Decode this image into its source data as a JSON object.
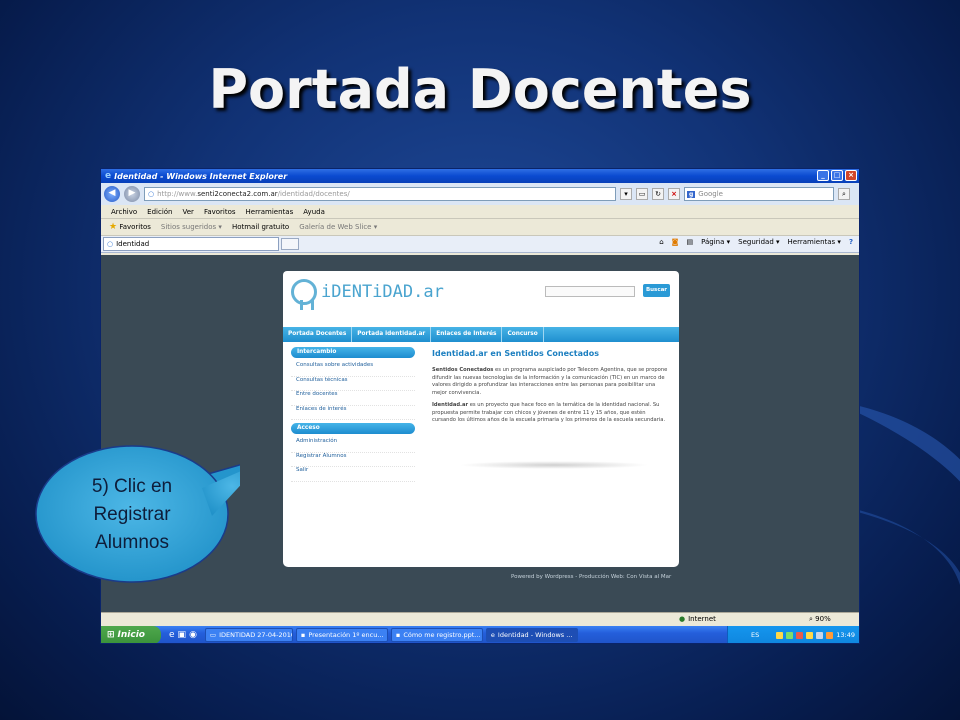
{
  "slide": {
    "title": "Portada Docentes"
  },
  "window": {
    "title": "Identidad - Windows Internet Explorer",
    "min": "_",
    "max": "□",
    "close": "×"
  },
  "address": {
    "url_prefix": "http://www.",
    "url_host": "senti2conecta2.com.ar",
    "url_path": "/identidad/docentes/",
    "search_placeholder": "Google"
  },
  "menu": [
    "Archivo",
    "Edición",
    "Ver",
    "Favoritos",
    "Herramientas",
    "Ayuda"
  ],
  "favorites": {
    "label": "Favoritos",
    "items": [
      "Sitios sugeridos ▾",
      "Hotmail gratuito",
      "Galería de Web Slice ▾"
    ]
  },
  "tab": {
    "label": "Identidad"
  },
  "commands": [
    "Página ▾",
    "Seguridad ▾",
    "Herramientas ▾"
  ],
  "site": {
    "logo": "iDENTiDAD.ar",
    "search_button": "Buscar",
    "nav": [
      "Portada Docentes",
      "Portada identidad.ar",
      "Enlaces de Interés",
      "Concurso"
    ],
    "sidebar": {
      "section1": "Intercambio",
      "links1": [
        "Consultas sobre actividades",
        "Consultas técnicas",
        "Entre docentes",
        "Enlaces de interés"
      ],
      "section2": "Acceso",
      "links2": [
        "Administración",
        "Registrar Alumnos",
        "Salir"
      ]
    },
    "article": {
      "title": "Identidad.ar en Sentidos Conectados",
      "p1_bold": "Sentidos Conectados",
      "p1": " es un programa auspiciado por Telecom Agentina, que se propone difundir las nuevas tecnologías de la información y la comunicación (TIC) en un marco de valores dirigido a profundizar las interacciones entre las personas para posibilitar una mejor convivencia.",
      "p2_bold": "Identidad.ar",
      "p2": " es un proyecto que hace foco en la temática de la identidad nacional. Su propuesta permite trabajar con chicos y jóvenes de entre 11 y 15 años, que estén cursando los últimos años de la escuela primaria y los primeros de la escuela secundaria."
    },
    "footer": "Powered by Wordpress - Producción Web: Con Vista al Mar"
  },
  "status": {
    "zone": "Internet",
    "zoom": "90%"
  },
  "taskbar": {
    "start": "Inicio",
    "tasks": [
      "IDENTIDAD 27-04-2010",
      "Presentación 1º encu...",
      "Cómo me registro.ppt...",
      "Identidad - Windows ..."
    ],
    "lang": "ES",
    "clock": "13:49"
  },
  "callout": {
    "line1": "5) Clic en",
    "line2": "Registrar",
    "line3": "Alumnos"
  }
}
